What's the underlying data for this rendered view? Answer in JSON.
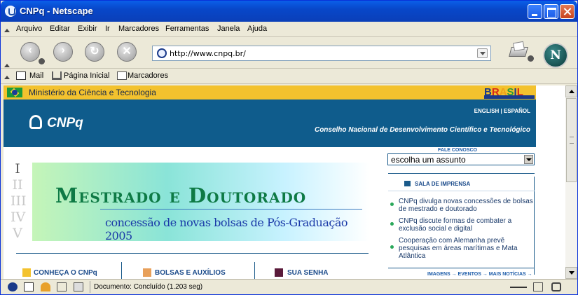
{
  "window": {
    "title": "CNPq - Netscape"
  },
  "menu": [
    "Arquivo",
    "Editar",
    "Exibir",
    "Ir",
    "Marcadores",
    "Ferramentas",
    "Janela",
    "Ajuda"
  ],
  "nav": {
    "back_icon": "back-arrow-icon",
    "forward_icon": "forward-arrow-icon",
    "reload_icon": "reload-icon",
    "stop_icon": "stop-icon",
    "url": "http://www.cnpq.br/"
  },
  "personal_toolbar": {
    "mail": "Mail",
    "home": "Página Inicial",
    "bookmarks": "Marcadores"
  },
  "page": {
    "ministry": "Ministério da Ciência e Tecnologia",
    "brasil_logo": "BRASIL",
    "languages": "ENGLISH | ESPAÑOL",
    "logo_text": "CNPq",
    "council_name": "Conselho Nacional de Desenvolvimento Científico e Tecnológico",
    "roman_numerals": [
      "I",
      "II",
      "III",
      "IV",
      "V"
    ],
    "banner": {
      "title": "Mestrado e Doutorado",
      "subtitle": "concessão de novas bolsas de Pós-Graduação 2005"
    },
    "bottom_links": [
      "CONHEÇA O CNPq",
      "BOLSAS E AUXÍLIOS",
      "SUA SENHA"
    ],
    "contact": {
      "label": "FALE CONOSCO",
      "select_value": "escolha um assunto"
    },
    "press": {
      "heading": "SALA DE IMPRENSA",
      "items": [
        "CNPq divulga novas concessões de bolsas de mestrado e doutorado",
        "CNPq discute formas de combater a exclusão social e digital",
        "Cooperação com Alemanha prevê pesquisas em áreas marítimas e Mata Atlântica"
      ],
      "footer_links": "IMAGENS → EVENTOS → MAIS NOTÍCIAS →"
    }
  },
  "status": {
    "text": "Documento: Concluído (1.203 seg)"
  },
  "colors": {
    "title_bar": "#0a4fd8",
    "header": "#0f5c8c",
    "ministry_bar": "#f3c22e",
    "banner_title": "#0e7a45"
  }
}
